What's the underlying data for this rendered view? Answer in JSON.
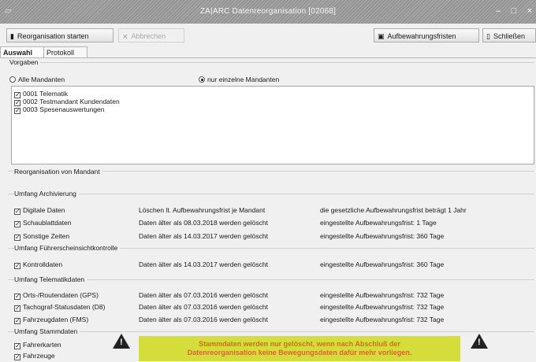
{
  "window": {
    "title": "ZA|ARC Datenreorganisation [02068]",
    "minimize": "–",
    "maximize": "□",
    "close": "×"
  },
  "toolbar": {
    "start": "Reorganisation starten",
    "cancel": "Abbrechen",
    "retention": "Aufbewahrungsfristen",
    "close": "Schließen"
  },
  "tabs": [
    "Auswahl",
    "Protokoll"
  ],
  "vorgaben": {
    "group": "Vorgaben",
    "radio_all": "Alle Mandanten",
    "radio_single": "nur einzelne Mandanten",
    "mandanten": [
      "0001 Telematik",
      "0002 Testmandant Kundendaten",
      "0003 Spesenauswertungen"
    ]
  },
  "reorg_group": "Reorganisation von Mandant",
  "archivierung": {
    "group": "Umfang Archivierung",
    "rows": [
      {
        "label": "Digitale Daten",
        "action": "Löschen lt. Aufbewahrungsfrist je Mandant",
        "info": "die gesetzliche Aufbewahrungsfrist beträgt 1 Jahr"
      },
      {
        "label": "Schaublattdaten",
        "action": "Daten älter als 08.03.2018 werden gelöscht",
        "info": "eingestellte Aufbewahrungsfrist: 1 Tage"
      },
      {
        "label": "Sonstige Zeiten",
        "action": "Daten älter als 14.03.2017 werden gelöscht",
        "info": "eingestellte Aufbewahrungsfrist: 360 Tage"
      }
    ]
  },
  "fuehrerschein": {
    "group": "Umfang Führerscheinsichtkontrolle",
    "rows": [
      {
        "label": "Kontrolldaten",
        "action": "Daten älter als 14.03.2017 werden gelöscht",
        "info": "eingestellte Aufbewahrungsfrist: 360 Tage"
      }
    ]
  },
  "telematik": {
    "group": "Umfang Telematikdaten",
    "rows": [
      {
        "label": "Orts-/Routendaten (GPS)",
        "action": "Daten älter als 07.03.2016 werden gelöscht",
        "info": "eingestellte Aufbewahrungsfrist: 732 Tage"
      },
      {
        "label": "Tachograf-Statusdaten (D8)",
        "action": "Daten älter als 07.03.2016 werden gelöscht",
        "info": "eingestellte Aufbewahrungsfrist: 732 Tage"
      },
      {
        "label": "Fahrzeugdaten (FMS)",
        "action": "Daten älter als 07.03.2016 werden gelöscht",
        "info": "eingestellte Aufbewahrungsfrist: 732 Tage"
      }
    ]
  },
  "stammdaten": {
    "group": "Umfang Stammdaten",
    "items": [
      "Fahrerkarten",
      "Fahrzeuge"
    ],
    "notice_line1": "Stammdaten werden nur gelöscht, wenn nach Abschluß der",
    "notice_line2": "Datenreorganisation keine Bewegungsdaten dafür mehr vorliegen."
  },
  "colors": {
    "notice_bg": "#d4dd3a",
    "notice_text": "#d46a2a"
  }
}
